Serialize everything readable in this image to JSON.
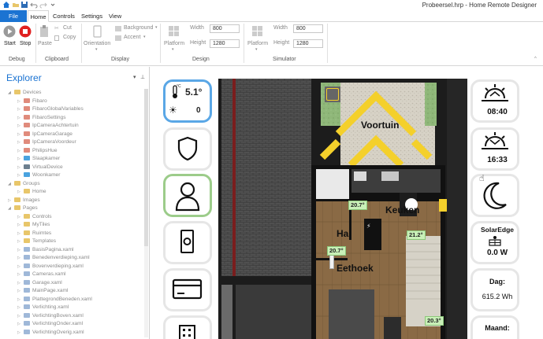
{
  "window": {
    "title": "Probeersel.hrp - Home Remote Designer"
  },
  "menu": {
    "tabs": [
      "File",
      "Home",
      "Controls",
      "Settings",
      "View"
    ]
  },
  "ribbon": {
    "debug": {
      "start": "Start",
      "stop": "Stop",
      "label": "Debug"
    },
    "clipboard": {
      "paste": "Paste",
      "cut": "Cut",
      "copy": "Copy",
      "label": "Clipboard"
    },
    "display": {
      "orientation": "Orientation",
      "background": "Background",
      "accent": "Accent",
      "label": "Display"
    },
    "design": {
      "platform": "Platform",
      "width_label": "Width",
      "width_value": "800",
      "height_label": "Height",
      "height_value": "1280",
      "label": "Design"
    },
    "simulator": {
      "platform": "Platform",
      "width_label": "Width",
      "width_value": "800",
      "height_label": "Height",
      "height_value": "1280",
      "label": "Simulator"
    }
  },
  "explorer": {
    "title": "Explorer",
    "pin": "▾ ⊥",
    "tree": [
      {
        "label": "Devices",
        "level": 1,
        "icon": "folder",
        "expanded": true
      },
      {
        "label": "Fibaro",
        "level": 2,
        "icon": "device"
      },
      {
        "label": "FibaroGlobalVariables",
        "level": 2,
        "icon": "device"
      },
      {
        "label": "FibaroSettings",
        "level": 2,
        "icon": "device"
      },
      {
        "label": "IpCameraAchtertuin",
        "level": 2,
        "icon": "device"
      },
      {
        "label": "IpCameraGarage",
        "level": 2,
        "icon": "device"
      },
      {
        "label": "IpCameraVoordeur",
        "level": 2,
        "icon": "device"
      },
      {
        "label": "PhilipsHue",
        "level": 2,
        "icon": "device"
      },
      {
        "label": "Slaapkamer",
        "level": 2,
        "icon": "sensor"
      },
      {
        "label": "VirtualDevice",
        "level": 2,
        "icon": "virtual"
      },
      {
        "label": "Woonkamer",
        "level": 2,
        "icon": "sensor"
      },
      {
        "label": "Groups",
        "level": 1,
        "icon": "folder",
        "expanded": true
      },
      {
        "label": "Home",
        "level": 2,
        "icon": "folder"
      },
      {
        "label": "Images",
        "level": 1,
        "icon": "folder"
      },
      {
        "label": "Pages",
        "level": 1,
        "icon": "folder",
        "expanded": true
      },
      {
        "label": "Controls",
        "level": 2,
        "icon": "folder"
      },
      {
        "label": "MyTiles",
        "level": 2,
        "icon": "folder"
      },
      {
        "label": "Ruimtes",
        "level": 2,
        "icon": "folder"
      },
      {
        "label": "Templates",
        "level": 2,
        "icon": "folder"
      },
      {
        "label": "BasisPagina.xaml",
        "level": 2,
        "icon": "file"
      },
      {
        "label": "Benedenverdieping.xaml",
        "level": 2,
        "icon": "file"
      },
      {
        "label": "Bovenverdieping.xaml",
        "level": 2,
        "icon": "file"
      },
      {
        "label": "Cameras.xaml",
        "level": 2,
        "icon": "file"
      },
      {
        "label": "Garage.xaml",
        "level": 2,
        "icon": "file"
      },
      {
        "label": "MainPage.xaml",
        "level": 2,
        "icon": "file"
      },
      {
        "label": "PlattegrondBeneden.xaml",
        "level": 2,
        "icon": "file"
      },
      {
        "label": "Verlichting.xaml",
        "level": 2,
        "icon": "file"
      },
      {
        "label": "VerlichtingBoven.xaml",
        "level": 2,
        "icon": "file"
      },
      {
        "label": "VerlichtingOnder.xaml",
        "level": 2,
        "icon": "file"
      },
      {
        "label": "VerlichtingOverig.xaml",
        "level": 2,
        "icon": "file"
      }
    ]
  },
  "left_tiles": {
    "temperature": "5.1°",
    "temp_unit": "°C",
    "light_level": "0"
  },
  "floorplan": {
    "rooms": {
      "voortuin": "Voortuin",
      "keuken": "Keuken",
      "hal": "Hal",
      "eethoek": "Eethoek"
    },
    "temps": [
      "20.7°",
      "21.2°",
      "20.7°",
      "20.3°"
    ]
  },
  "right_tiles": {
    "sunrise": "08:40",
    "sunset": "16:33",
    "solar_title": "SolarEdge",
    "solar_power": "0.0 W",
    "day_title": "Dag:",
    "day_value": "615.2 Wh",
    "month_title": "Maand:"
  }
}
